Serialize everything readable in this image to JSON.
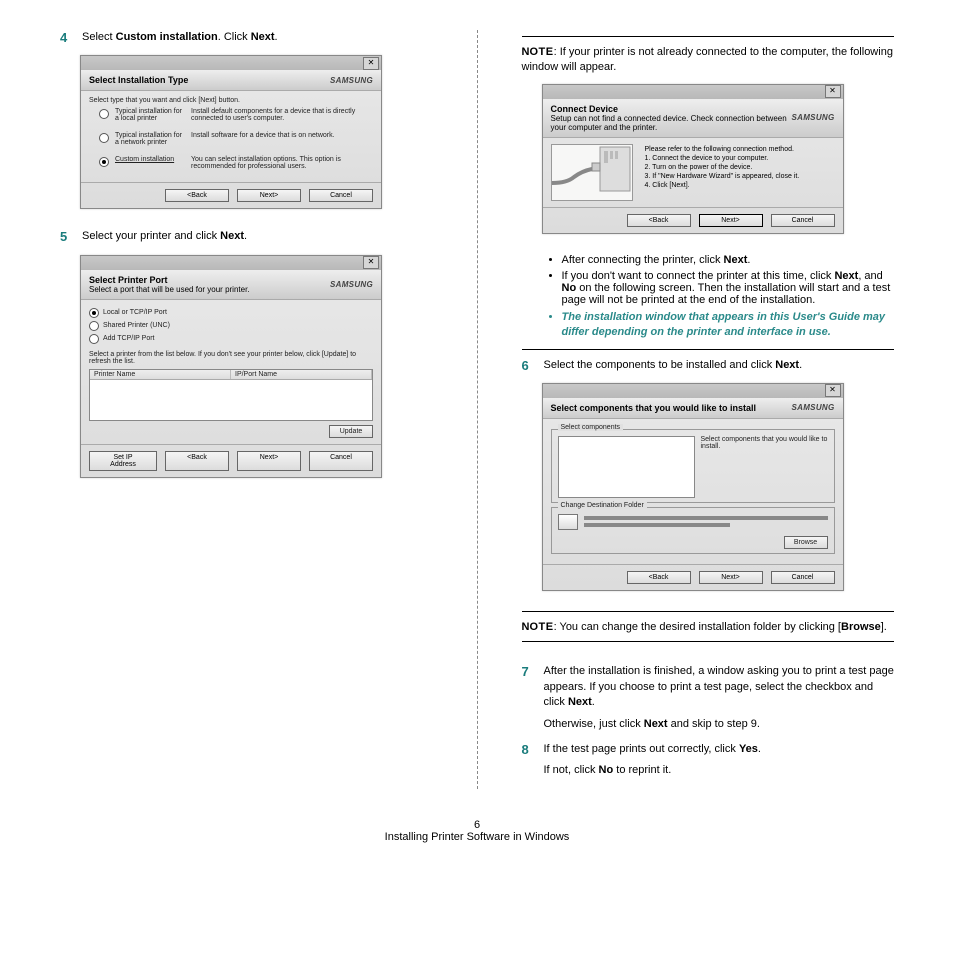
{
  "left": {
    "step4": {
      "num": "4",
      "text_a": "Select ",
      "bold_a": "Custom installation",
      "text_b": ". Click ",
      "bold_b": "Next",
      "text_c": "."
    },
    "win1": {
      "title": "Select Installation Type",
      "brand": "SAMSUNG",
      "instr": "Select type that you want and click [Next] button.",
      "opts": [
        {
          "label": "Typical installation for a local printer",
          "desc": "Install default components for a device that is directly connected to user's computer."
        },
        {
          "label": "Typical installation for a network printer",
          "desc": "Install software for a device that is on network."
        },
        {
          "label": "Custom installation",
          "desc": "You can select installation options. This option is recommended for professional users."
        }
      ],
      "btns": {
        "back": "<Back",
        "next": "Next>",
        "cancel": "Cancel"
      }
    },
    "step5": {
      "num": "5",
      "text_a": "Select your printer and click ",
      "bold_a": "Next",
      "text_b": "."
    },
    "win2": {
      "title": "Select Printer Port",
      "sub": "Select a port that will be used for your printer.",
      "brand": "SAMSUNG",
      "opts": [
        "Local or TCP/IP Port",
        "Shared Printer (UNC)",
        "Add TCP/IP Port"
      ],
      "instr": "Select a printer from the list below. If you don't see your printer below, click [Update] to refresh the list.",
      "col1": "Printer Name",
      "col2": "IP/Port Name",
      "update": "Update",
      "setip": "Set IP Address",
      "btns": {
        "back": "<Back",
        "next": "Next>",
        "cancel": "Cancel"
      }
    }
  },
  "right": {
    "note1_a": "OTE",
    "note1_n": "N",
    "note1_txt": ": If your printer is not already connected to the computer, the following window will appear.",
    "win3": {
      "title": "Connect Device",
      "sub": "Setup can not find a connected device. Check connection between your computer and the printer.",
      "brand": "SAMSUNG",
      "p0": "Please refer to the following connection method.",
      "p1": "1. Connect the device to your computer.",
      "p2": "2. Turn on the power of the device.",
      "p3": "3. If \"New Hardware Wizard\" is appeared, close it.",
      "p4": "4. Click [Next].",
      "btns": {
        "back": "<Back",
        "next": "Next>",
        "cancel": "Cancel"
      }
    },
    "bullet1_a": "After connecting the printer, click ",
    "bullet1_b": "Next",
    "bullet1_c": ".",
    "bullet2": "If you don't want to connect the printer at this time, click ",
    "bullet2_b1": "Next",
    "bullet2_mid": ", and ",
    "bullet2_b2": "No",
    "bullet2_end": " on the following screen. Then the installation will start and a test page will not be printed at the end of the installation.",
    "bullet3": "The installation window that appears in this User's Guide may differ depending on the printer and interface in use.",
    "step6": {
      "num": "6",
      "text_a": "Select the components to be installed and click ",
      "bold_a": "Next",
      "text_b": "."
    },
    "win4": {
      "title": "Select components that you would like to install",
      "brand": "SAMSUNG",
      "group1": "Select components",
      "desc": "Select components that you would like to install.",
      "group2": "Change Destination Folder",
      "browse": "Browse",
      "btns": {
        "back": "<Back",
        "next": "Next>",
        "cancel": "Cancel"
      }
    },
    "note2_n": "N",
    "note2_a": "OTE",
    "note2_txt_a": ": You can change the desired installation folder by clicking [",
    "note2_b": "Browse",
    "note2_txt_b": "].",
    "step7": {
      "num": "7",
      "t1": "After the installation is finished, a window asking you to print a test page appears. If you choose to print a test page, select the checkbox and click ",
      "b1": "Next",
      "t1b": ".",
      "t2a": "Otherwise, just click ",
      "b2": "Next",
      "t2b": " and skip to step 9."
    },
    "step8": {
      "num": "8",
      "t1": "If the test page prints out correctly, click ",
      "b1": "Yes",
      "t1b": ".",
      "t2": "If not, click ",
      "b2": "No",
      "t2b": " to reprint it."
    }
  },
  "footer": {
    "page": "6",
    "chapter": "Installing Printer Software in Windows"
  }
}
